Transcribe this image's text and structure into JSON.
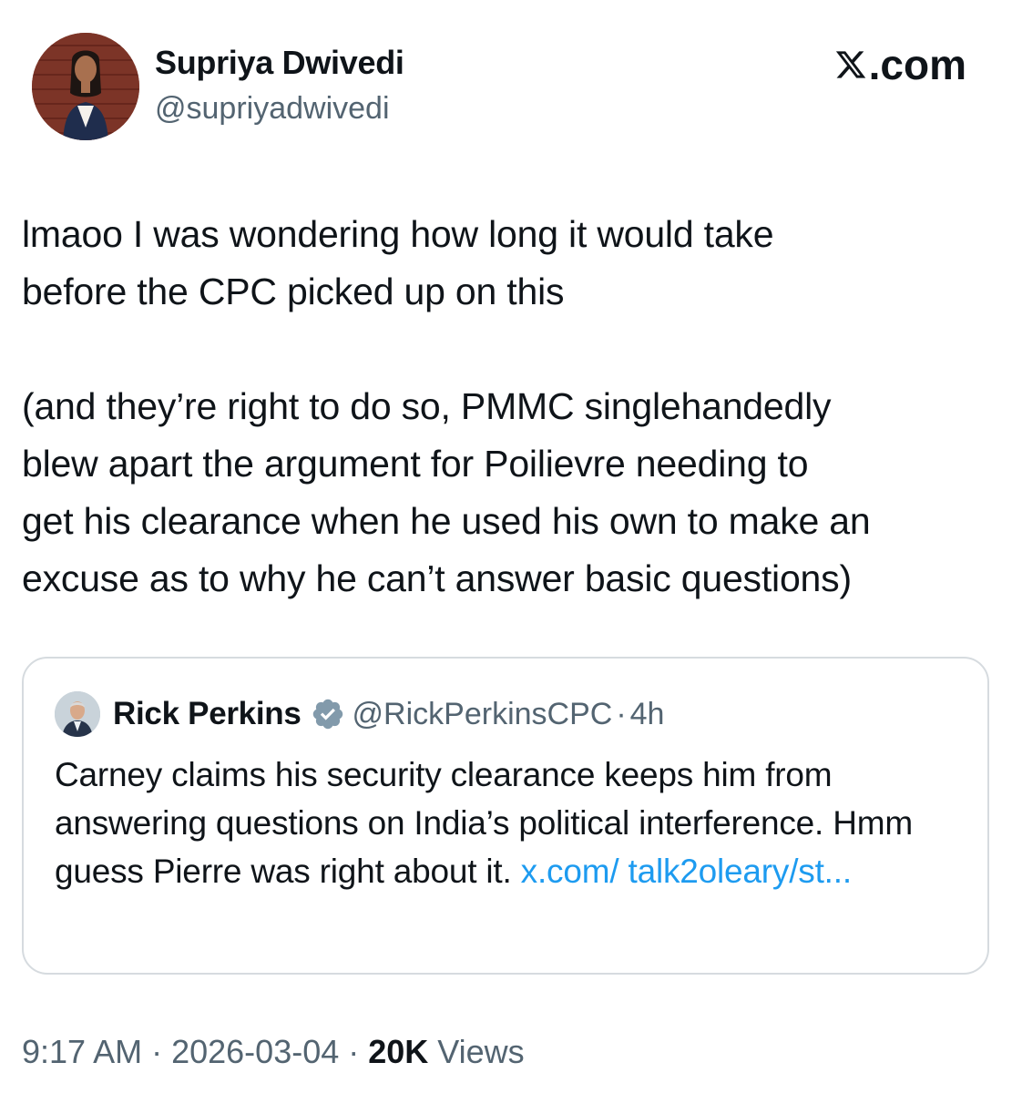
{
  "author": {
    "name": "Supriya Dwivedi",
    "handle": "@supriyadwivedi"
  },
  "brand": {
    "label": ".com",
    "icon": "x-logo-icon"
  },
  "tweet": {
    "text": "lmaoo I was wondering how long it would take\nbefore the CPC picked up on this\n\n(and they’re right to do so, PMMC singlehandedly\nblew apart the argument for Poilievre needing to\nget his clearance when he used his own to make an\nexcuse as to why he can’t answer basic questions)"
  },
  "quote": {
    "name": "Rick Perkins",
    "badge_icon": "verified-badge-icon",
    "handle": "@RickPerkinsCPC",
    "separator": "·",
    "time": "4h",
    "text": "Carney claims his security clearance keeps him from answering questions on India’s political interference. Hmm guess Pierre was right about it. ",
    "link": "x.com/ talk2oleary/st..."
  },
  "meta": {
    "time": "9:17 AM",
    "sep1": " · ",
    "date": "2026-03-04",
    "sep2": " · ",
    "views_count": "20K",
    "views_label": " Views"
  },
  "colors": {
    "text": "#0f1419",
    "secondary": "#536471",
    "link": "#1d9bf0",
    "border": "#d6dbdf",
    "badge": "#829aab"
  }
}
